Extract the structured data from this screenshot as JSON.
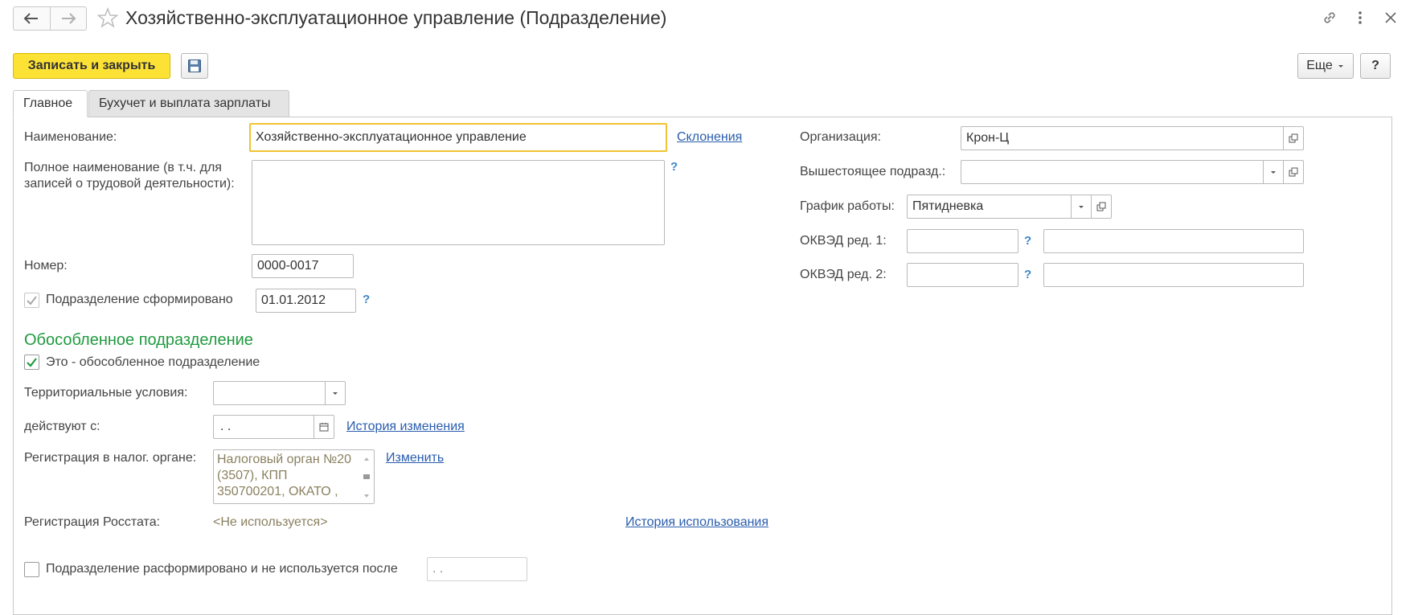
{
  "window": {
    "title": "Хозяйственно-эксплуатационное управление (Подразделение)"
  },
  "toolbar": {
    "save_close_label": "Записать и закрыть",
    "more_label": "Еще",
    "help_label": "?"
  },
  "tabs": [
    {
      "label": "Главное",
      "active": true
    },
    {
      "label": "Бухучет и выплата зарплаты",
      "active": false
    }
  ],
  "form": {
    "name_label": "Наименование:",
    "name_value": "Хозяйственно-эксплуатационное управление",
    "declensions_link": "Склонения",
    "fullname_label": "Полное наименование (в т.ч. для записей о трудовой деятельности):",
    "fullname_value": "",
    "help_mark": "?",
    "number_label": "Номер:",
    "number_value": "0000-0017",
    "formed_label": "Подразделение сформировано",
    "formed_checked": true,
    "formed_date": "01.01.2012",
    "separate_section_title": "Обособленное подразделение",
    "separate_label": "Это - обособленное подразделение",
    "separate_checked": true,
    "territorial_label": "Территориальные условия:",
    "territorial_value": "",
    "valid_from_label": "действуют с:",
    "valid_from_value": " .  .",
    "change_history_link": "История изменения",
    "tax_reg_label": "Регистрация в налог. органе:",
    "tax_reg_value": "Налоговый орган №20 (3507), КПП 350700201, ОКАТО ,",
    "change_link": "Изменить",
    "rosstat_label": "Регистрация Росстата:",
    "rosstat_value": "<Не используется>",
    "usage_history_link": "История использования",
    "disbanded_label": "Подразделение расформировано и не используется после",
    "disbanded_checked": false,
    "disbanded_date": " .  ."
  },
  "right": {
    "org_label": "Организация:",
    "org_value": "Крон-Ц",
    "parent_label": "Вышестоящее подразд.:",
    "parent_value": "",
    "schedule_label": "График работы:",
    "schedule_value": "Пятидневка",
    "okved1_label": "ОКВЭД ред. 1:",
    "okved1_code": "",
    "okved1_name": "",
    "okved2_label": "ОКВЭД ред. 2:",
    "okved2_code": "",
    "okved2_name": ""
  },
  "colors": {
    "primary_button": "#fde236",
    "focus_border": "#f1c232",
    "section_title": "#1f9a3f",
    "link": "#2a5dad",
    "help_mark": "#3a86c8"
  },
  "icons": [
    "back-arrow-icon",
    "forward-arrow-icon",
    "star-icon",
    "link-icon",
    "more-vertical-icon",
    "close-icon",
    "floppy-disk-icon",
    "open-form-icon",
    "dropdown-arrow-icon",
    "calendar-icon",
    "checkmark-icon"
  ]
}
